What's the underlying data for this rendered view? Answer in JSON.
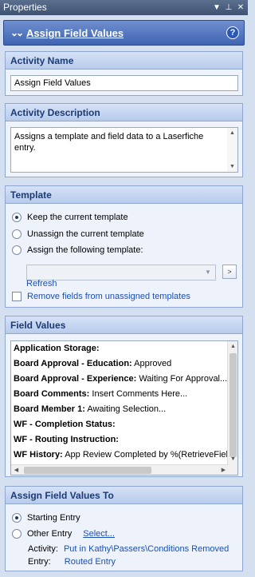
{
  "window": {
    "title": "Properties",
    "controls": [
      "dropdown-icon",
      "pin-icon",
      "close-icon"
    ]
  },
  "header": {
    "title": "Assign Field Values",
    "icons": [
      "double-chevron-down-icon",
      "help-icon"
    ]
  },
  "activity_name": {
    "header": "Activity Name",
    "value": "Assign Field Values"
  },
  "activity_description": {
    "header": "Activity Description",
    "value": "Assigns a template and field data to a Laserfiche entry."
  },
  "template": {
    "header": "Template",
    "options": [
      {
        "label": "Keep the current template",
        "checked": true
      },
      {
        "label": "Unassign the current template",
        "checked": false
      },
      {
        "label": "Assign the following template:",
        "checked": false
      }
    ],
    "select_value": "",
    "browse_label": ">",
    "refresh_label": "Refresh",
    "remove_fields_label": "Remove fields from unassigned templates",
    "remove_fields_checked": false
  },
  "field_values": {
    "header": "Field Values",
    "rows": [
      {
        "name": "Application Storage:",
        "value": ""
      },
      {
        "name": "Board Approval - Education:",
        "value": "Approved"
      },
      {
        "name": "Board Approval - Experience:",
        "value": "Waiting For Approval..."
      },
      {
        "name": "Board Comments:",
        "value": "Insert Comments Here..."
      },
      {
        "name": "Board Member 1:",
        "value": "Awaiting Selection..."
      },
      {
        "name": "WF - Completion Status:",
        "value": ""
      },
      {
        "name": "WF - Routing Instruction:",
        "value": ""
      },
      {
        "name": "WF History:",
        "value": "App Review Completed by %(RetrieveFieldVa"
      }
    ]
  },
  "assign_to": {
    "header": "Assign Field Values To",
    "options": [
      {
        "label": "Starting Entry",
        "checked": true
      },
      {
        "label": "Other Entry",
        "checked": false
      }
    ],
    "select_link": "Select...",
    "activity_label": "Activity:",
    "activity_value": "Put in Kathy\\Passers\\Conditions Removed",
    "entry_label": "Entry:",
    "entry_value": "Routed Entry"
  },
  "colors": {
    "header_blue": "#3f64b2",
    "group_header_text": "#1c3a73",
    "link": "#1c4fb0"
  }
}
